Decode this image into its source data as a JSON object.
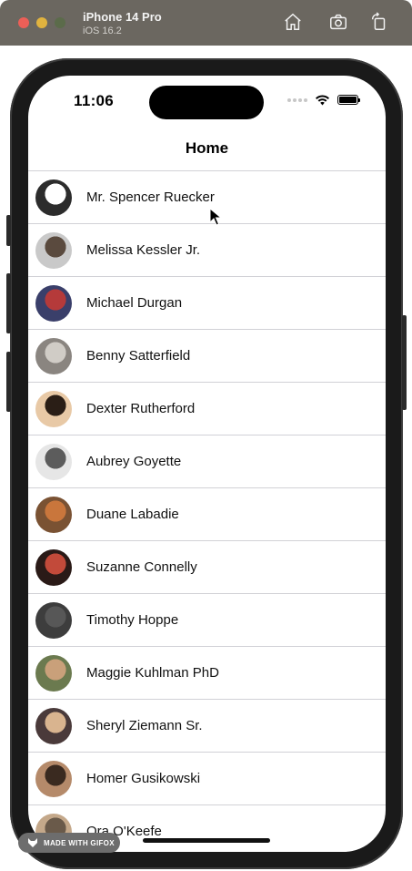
{
  "simulator": {
    "device_name": "iPhone 14 Pro",
    "os_version": "iOS 16.2",
    "controls": [
      {
        "name": "home-icon"
      },
      {
        "name": "screenshot-icon"
      },
      {
        "name": "rotate-icon"
      }
    ]
  },
  "status_bar": {
    "time": "11:06"
  },
  "nav": {
    "title": "Home"
  },
  "contacts": [
    {
      "name": "Mr. Spencer Ruecker",
      "avatar_color": "#2c2c2c",
      "avatar_accent": "#ffffff"
    },
    {
      "name": "Melissa Kessler Jr.",
      "avatar_color": "#c9c9c9",
      "avatar_accent": "#5a4a3e"
    },
    {
      "name": "Michael Durgan",
      "avatar_color": "#3a3f6a",
      "avatar_accent": "#b53a3a"
    },
    {
      "name": "Benny Satterfield",
      "avatar_color": "#8a8580",
      "avatar_accent": "#d0ccc6"
    },
    {
      "name": "Dexter Rutherford",
      "avatar_color": "#e8c9a6",
      "avatar_accent": "#2a1e16"
    },
    {
      "name": "Aubrey Goyette",
      "avatar_color": "#e6e6e6",
      "avatar_accent": "#5c5c5c"
    },
    {
      "name": "Duane Labadie",
      "avatar_color": "#7a5233",
      "avatar_accent": "#c9763c"
    },
    {
      "name": "Suzanne Connelly",
      "avatar_color": "#2a1a17",
      "avatar_accent": "#c24a3a"
    },
    {
      "name": "Timothy Hoppe",
      "avatar_color": "#3d3d3d",
      "avatar_accent": "#575757"
    },
    {
      "name": "Maggie Kuhlman PhD",
      "avatar_color": "#6b7a4f",
      "avatar_accent": "#c9a07a"
    },
    {
      "name": "Sheryl Ziemann Sr.",
      "avatar_color": "#4a3a3a",
      "avatar_accent": "#d9b48f"
    },
    {
      "name": "Homer Gusikowski",
      "avatar_color": "#b58a6a",
      "avatar_accent": "#3a2a20"
    },
    {
      "name": "Ora O'Keefe",
      "avatar_color": "#c4a88a",
      "avatar_accent": "#6a5a4a"
    }
  ],
  "watermark": {
    "text": "MADE WITH GIFOX"
  }
}
